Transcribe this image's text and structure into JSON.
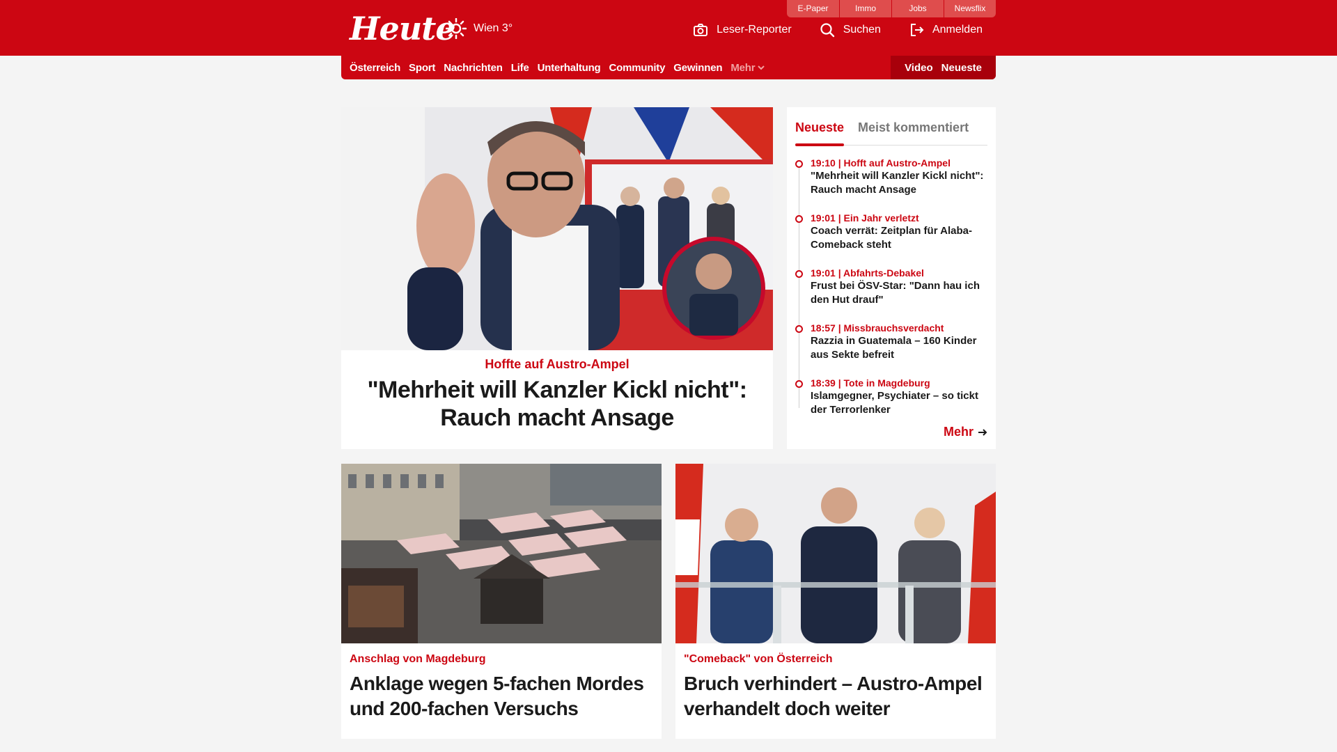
{
  "brand": {
    "logo": "Heute",
    "weather": "Wien 3°",
    "accent": "#cc0612"
  },
  "utility_links": [
    "E-Paper",
    "Immo",
    "Jobs",
    "Newsflix"
  ],
  "actions": {
    "reporter": "Leser-Reporter",
    "search": "Suchen",
    "login": "Anmelden"
  },
  "nav": {
    "items": [
      "Österreich",
      "Sport",
      "Nachrichten",
      "Life",
      "Unterhaltung",
      "Community",
      "Gewinnen"
    ],
    "more": "Mehr",
    "video": "Video",
    "latest": "Neueste"
  },
  "hero": {
    "kicker": "Hoffte auf Austro-Ampel",
    "title": "\"Mehrheit will Kanzler Kickl nicht\": Rauch macht Ansage"
  },
  "sidebar": {
    "tabs": [
      "Neueste",
      "Meist kommentiert"
    ],
    "items": [
      {
        "meta": "19:10 | Hofft auf Austro-Ampel",
        "title": "\"Mehrheit will Kanzler Kickl nicht\": Rauch macht Ansage"
      },
      {
        "meta": "19:01 | Ein Jahr verletzt",
        "title": "Coach verrät: Zeitplan für Alaba-Comeback steht"
      },
      {
        "meta": "19:01 | Abfahrts-Debakel",
        "title": "Frust bei ÖSV-Star: \"Dann hau ich den Hut drauf\""
      },
      {
        "meta": "18:57 | Missbrauchsverdacht",
        "title": "Razzia in Guatemala – 160 Kinder aus Sekte befreit"
      },
      {
        "meta": "18:39 | Tote in Magdeburg",
        "title": "Islamgegner, Psychiater – so tickt der Terrorlenker"
      }
    ],
    "more": "Mehr"
  },
  "cards": [
    {
      "kicker": "Anschlag von Magdeburg",
      "title": "Anklage wegen 5-fachen Mordes und 200-fachen Versuchs"
    },
    {
      "kicker": "\"Comeback\" von Österreich",
      "title": "Bruch verhindert – Austro-Ampel verhandelt doch weiter"
    }
  ]
}
